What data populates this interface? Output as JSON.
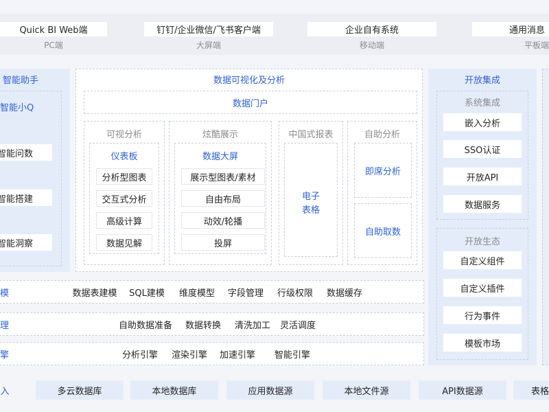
{
  "clients": [
    {
      "name": "Quick BI Web端",
      "sub": "PC端"
    },
    {
      "name": "钉钉/企业微信/飞书客户端",
      "sub": "大屏端"
    },
    {
      "name": "企业自有系统",
      "sub": "移动端"
    },
    {
      "name": "通用消息",
      "sub": "平板端"
    }
  ],
  "assistant": {
    "title": "智能助手",
    "q_label": "智能小Q",
    "items": [
      "智能问数",
      "智能搭建",
      "智能洞察"
    ]
  },
  "viz": {
    "title": "数据可视化及分析",
    "portal": "数据门户",
    "columns": [
      {
        "title": "可视分析",
        "sub": "仪表板",
        "items": [
          "分析型图表",
          "交互式分析",
          "高级计算",
          "数据见解"
        ]
      },
      {
        "title": "炫酷展示",
        "sub": "数据大屏",
        "items": [
          "展示型图表/素材",
          "自由布局",
          "动效/轮播",
          "投屏"
        ]
      },
      {
        "title": "中国式报表",
        "sub_line1": "电子",
        "sub_line2": "表格"
      },
      {
        "title": "自助分析",
        "items": [
          "即席分析",
          "自助取数"
        ]
      }
    ]
  },
  "open": {
    "title": "开放集成",
    "groups": [
      {
        "title": "系统集成",
        "items": [
          "嵌入分析",
          "SSO认证",
          "开放API",
          "数据服务"
        ]
      },
      {
        "title": "开放生态",
        "items": [
          "自定义组件",
          "自定义插件",
          "行为事件",
          "模板市场"
        ]
      }
    ]
  },
  "rows": [
    {
      "label": "模",
      "items": [
        "数据表建模",
        "SQL建模",
        "维度模型",
        "字段管理",
        "行级权限",
        "数据缓存"
      ]
    },
    {
      "label": "理",
      "items": [
        "自助数据准备",
        "数据转换",
        "清洗加工",
        "灵活调度"
      ]
    },
    {
      "label": "擎",
      "items": [
        "分析引擎",
        "渲染引擎",
        "加速引擎",
        "智能引擎"
      ]
    }
  ],
  "sources": {
    "label": "入",
    "items": [
      "多云数据库",
      "本地数据库",
      "应用数据源",
      "本地文件源",
      "API数据源",
      "表格"
    ]
  },
  "colors": {
    "accent": "#2f62d6",
    "panel_blue": "#e5ecf9",
    "band_gray": "#eceef3"
  }
}
